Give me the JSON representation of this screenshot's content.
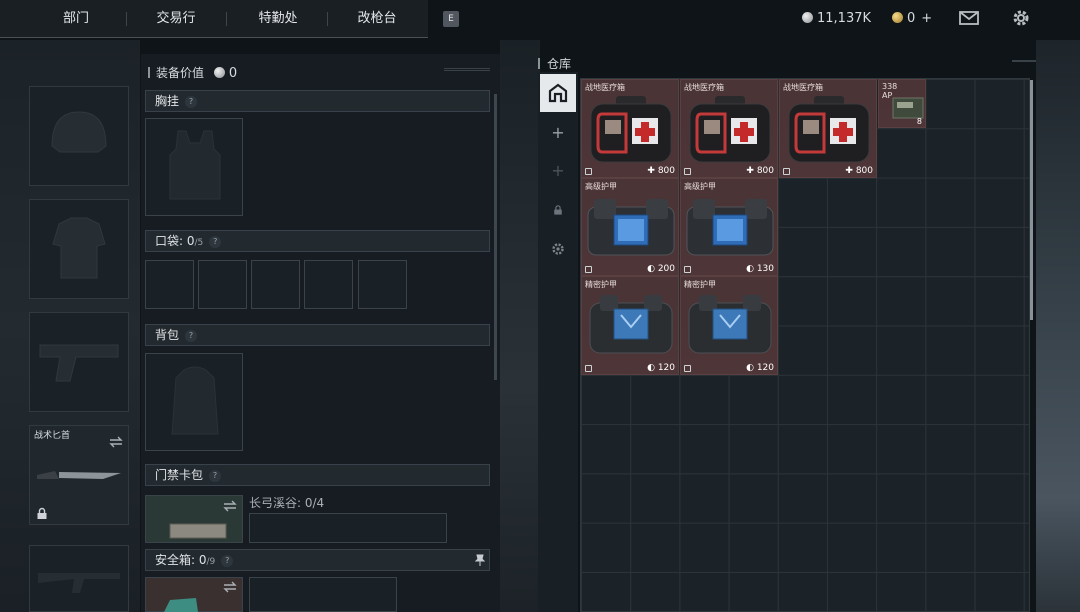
{
  "topnav": {
    "tabs": [
      "部门",
      "交易行",
      "特勤处",
      "改枪台"
    ],
    "key_hint": "E"
  },
  "currency": {
    "silver": "11,137K",
    "gold": "0"
  },
  "loadout": {
    "equipment_value_label": "装备价值",
    "equipment_value": "0",
    "chest_rig": "胸挂",
    "pocket_label": "口袋:",
    "pocket_count": "0",
    "pocket_capacity": "/5",
    "backpack": "背包",
    "keycard_case": "门禁卡包",
    "keycard_location": "长弓溪谷: 0/4",
    "safe_box_label": "安全箱:",
    "safe_box_count": "0",
    "safe_box_capacity": "/9",
    "knife_label": "战术匕首",
    "help": "?"
  },
  "inventory": {
    "title": "仓库",
    "items": [
      {
        "name": "战地医疗箱",
        "value": "800"
      },
      {
        "name": "战地医疗箱",
        "value": "800"
      },
      {
        "name": "战地医疗箱",
        "value": "800"
      },
      {
        "name": "338 AP",
        "value": "8"
      },
      {
        "name": "高级护甲",
        "value": "200"
      },
      {
        "name": "高级护甲",
        "value": "130"
      },
      {
        "name": "精密护甲",
        "value": "120"
      },
      {
        "name": "精密护甲",
        "value": "120"
      }
    ]
  },
  "icons": [
    "silver-coin-icon",
    "gold-coin-icon",
    "mail-icon",
    "gear-icon",
    "swap-icon",
    "lock-icon",
    "pin-icon",
    "warehouse-icon",
    "plus-icon"
  ],
  "colors": {
    "item_bg": "#4a3436",
    "panel_bg": "#161c21",
    "grid_bg": "#1c2328"
  }
}
